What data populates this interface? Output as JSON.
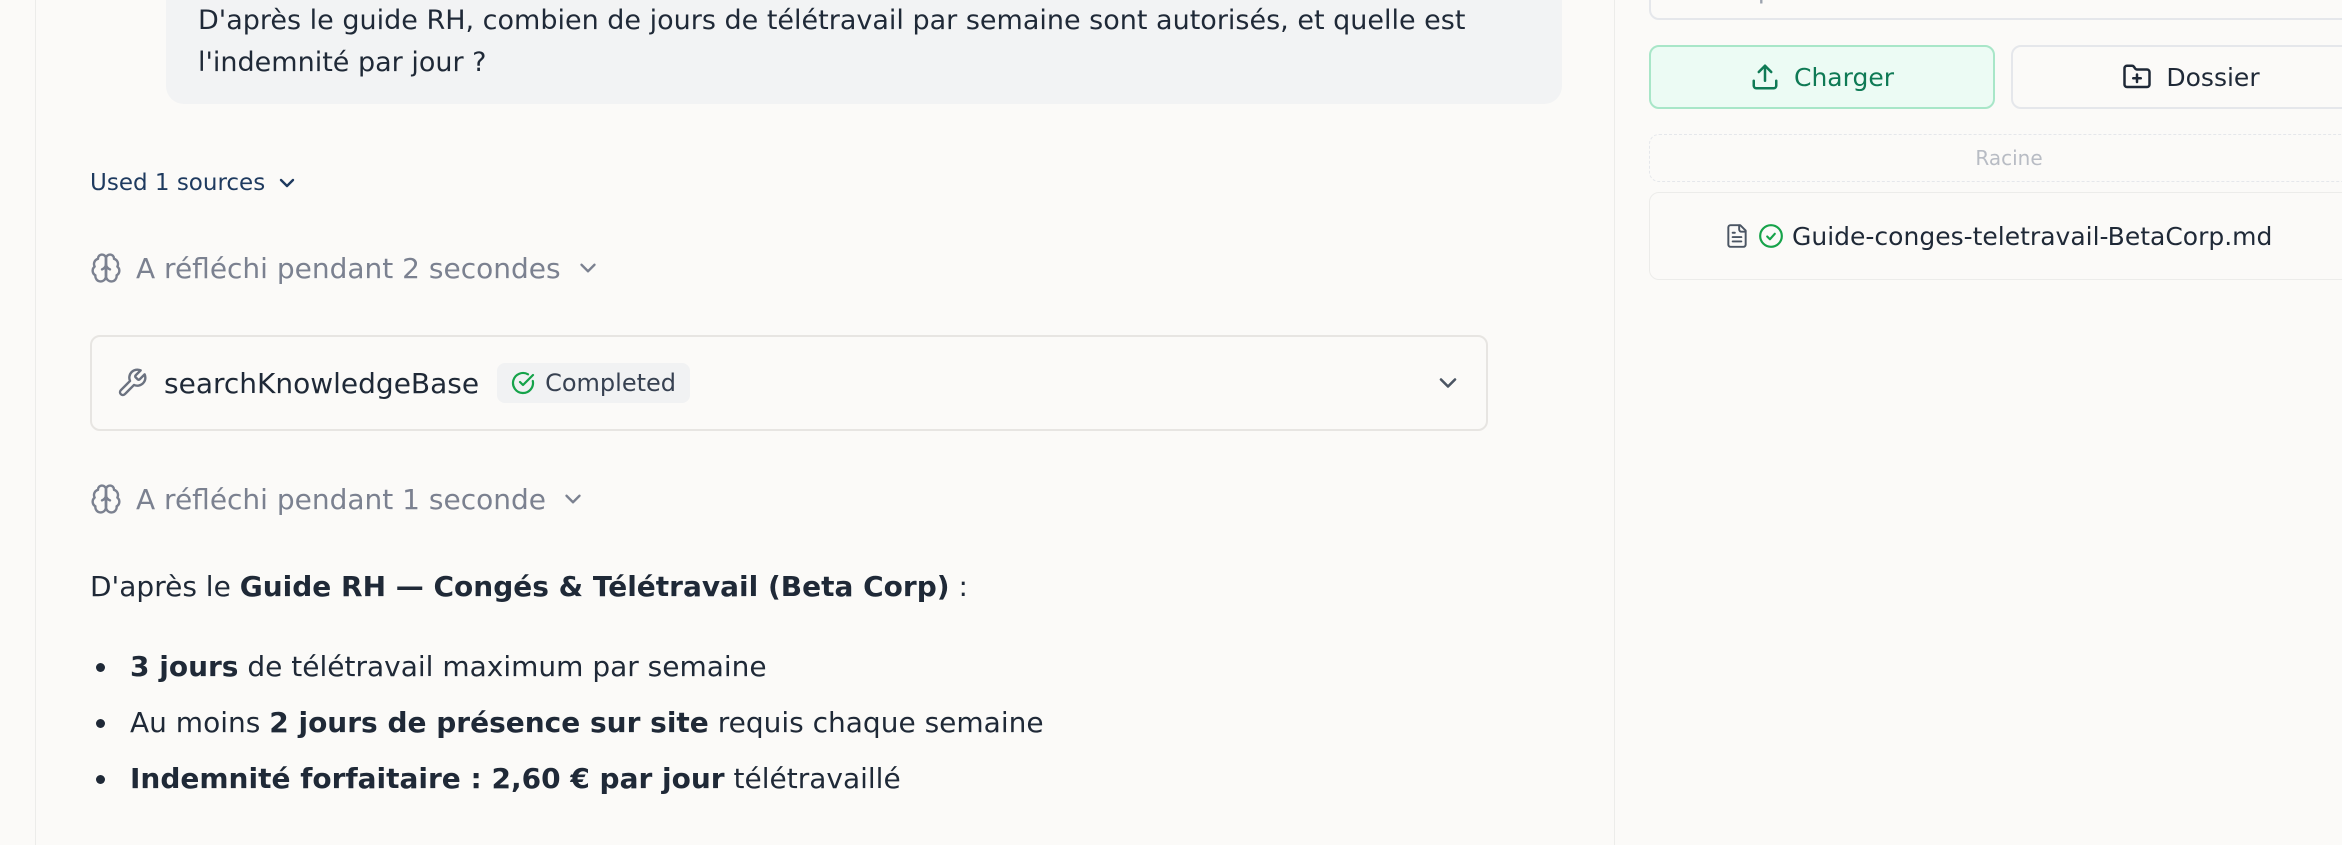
{
  "chat": {
    "user_message": "D'après le guide RH, combien de jours de télétravail par semaine sont autorisés, et quelle est l'indemnité par jour ?",
    "sources_label": "Used 1 sources",
    "thought_1": "A réfléchi pendant 2 secondes",
    "tool": {
      "name": "searchKnowledgeBase",
      "status": "Completed"
    },
    "thought_2": "A réfléchi pendant 1 seconde",
    "answer": {
      "intro_prefix": "D'après le ",
      "intro_bold": "Guide RH — Congés & Télétravail (Beta Corp)",
      "intro_suffix": " :",
      "bullets": [
        {
          "bold_prefix": "",
          "bold": "3 jours",
          "text": " de télétravail maximum par semaine"
        },
        {
          "bold_prefix": "Au moins ",
          "bold": "2 jours de présence sur site",
          "text": " requis chaque semaine"
        },
        {
          "bold_prefix": "",
          "bold": "Indemnité forfaitaire : 2,60 € par jour",
          "text": " télétravaillé"
        }
      ]
    }
  },
  "sidebar": {
    "filter_placeholder": "Filtrer par titre...",
    "upload_label": "Charger",
    "folder_label": "Dossier",
    "root_label": "Racine",
    "file_name": "Guide-conges-teletravail-BetaCorp.md"
  },
  "icons": {
    "brain": "brain-icon",
    "wrench": "wrench-icon",
    "check": "check-circle-icon",
    "chevron": "chevron-down-icon",
    "upload": "upload-icon",
    "folder_plus": "folder-plus-icon",
    "file": "file-text-icon"
  },
  "colors": {
    "accent_green": "#0f7a55",
    "link_navy": "#1e3a5f",
    "muted": "#7b8190"
  }
}
